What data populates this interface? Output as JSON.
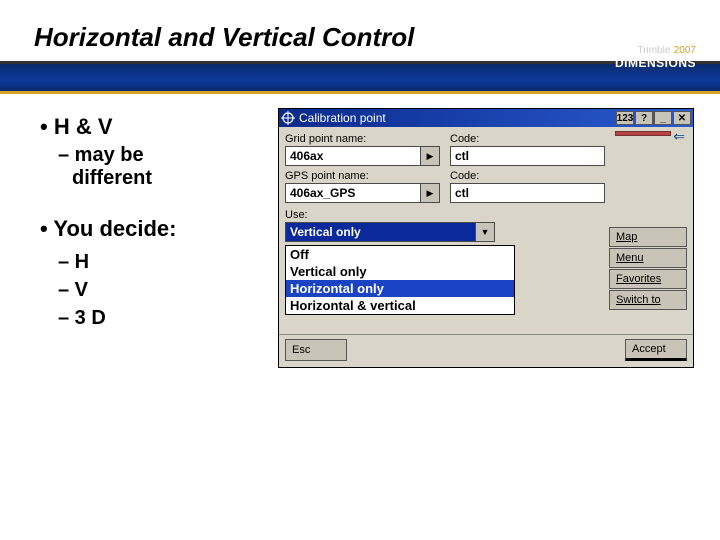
{
  "slide": {
    "title": "Horizontal and Vertical Control",
    "logo_brand": "Trimble",
    "logo_text": "DIMENSIONS",
    "logo_year": "2007",
    "b1": "• H & V",
    "sub1a": "– may be",
    "sub1b": "different",
    "b2": "• You decide:",
    "s2a": "– H",
    "s2b": "– V",
    "s2c": "– 3 D"
  },
  "app": {
    "title": "Calibration point",
    "btn_123": "123",
    "btn_help": "?",
    "btn_min": "_",
    "btn_close": "✕",
    "grid_label": "Grid point name:",
    "grid_value": "406ax",
    "code_label": "Code:",
    "code1_value": "ctl",
    "gps_label": "GPS point name:",
    "gps_value": "406ax_GPS",
    "code2_value": "ctl",
    "use_label": "Use:",
    "use_value": "Vertical only",
    "options": {
      "o1": "Off",
      "o2": "Vertical only",
      "o3": "Horizontal only",
      "o4": "Horizontal & vertical"
    },
    "side": {
      "map": "Map",
      "menu": "Menu",
      "fav": "Favorites",
      "switch": "Switch to"
    },
    "esc": "Esc",
    "accept": "Accept"
  }
}
